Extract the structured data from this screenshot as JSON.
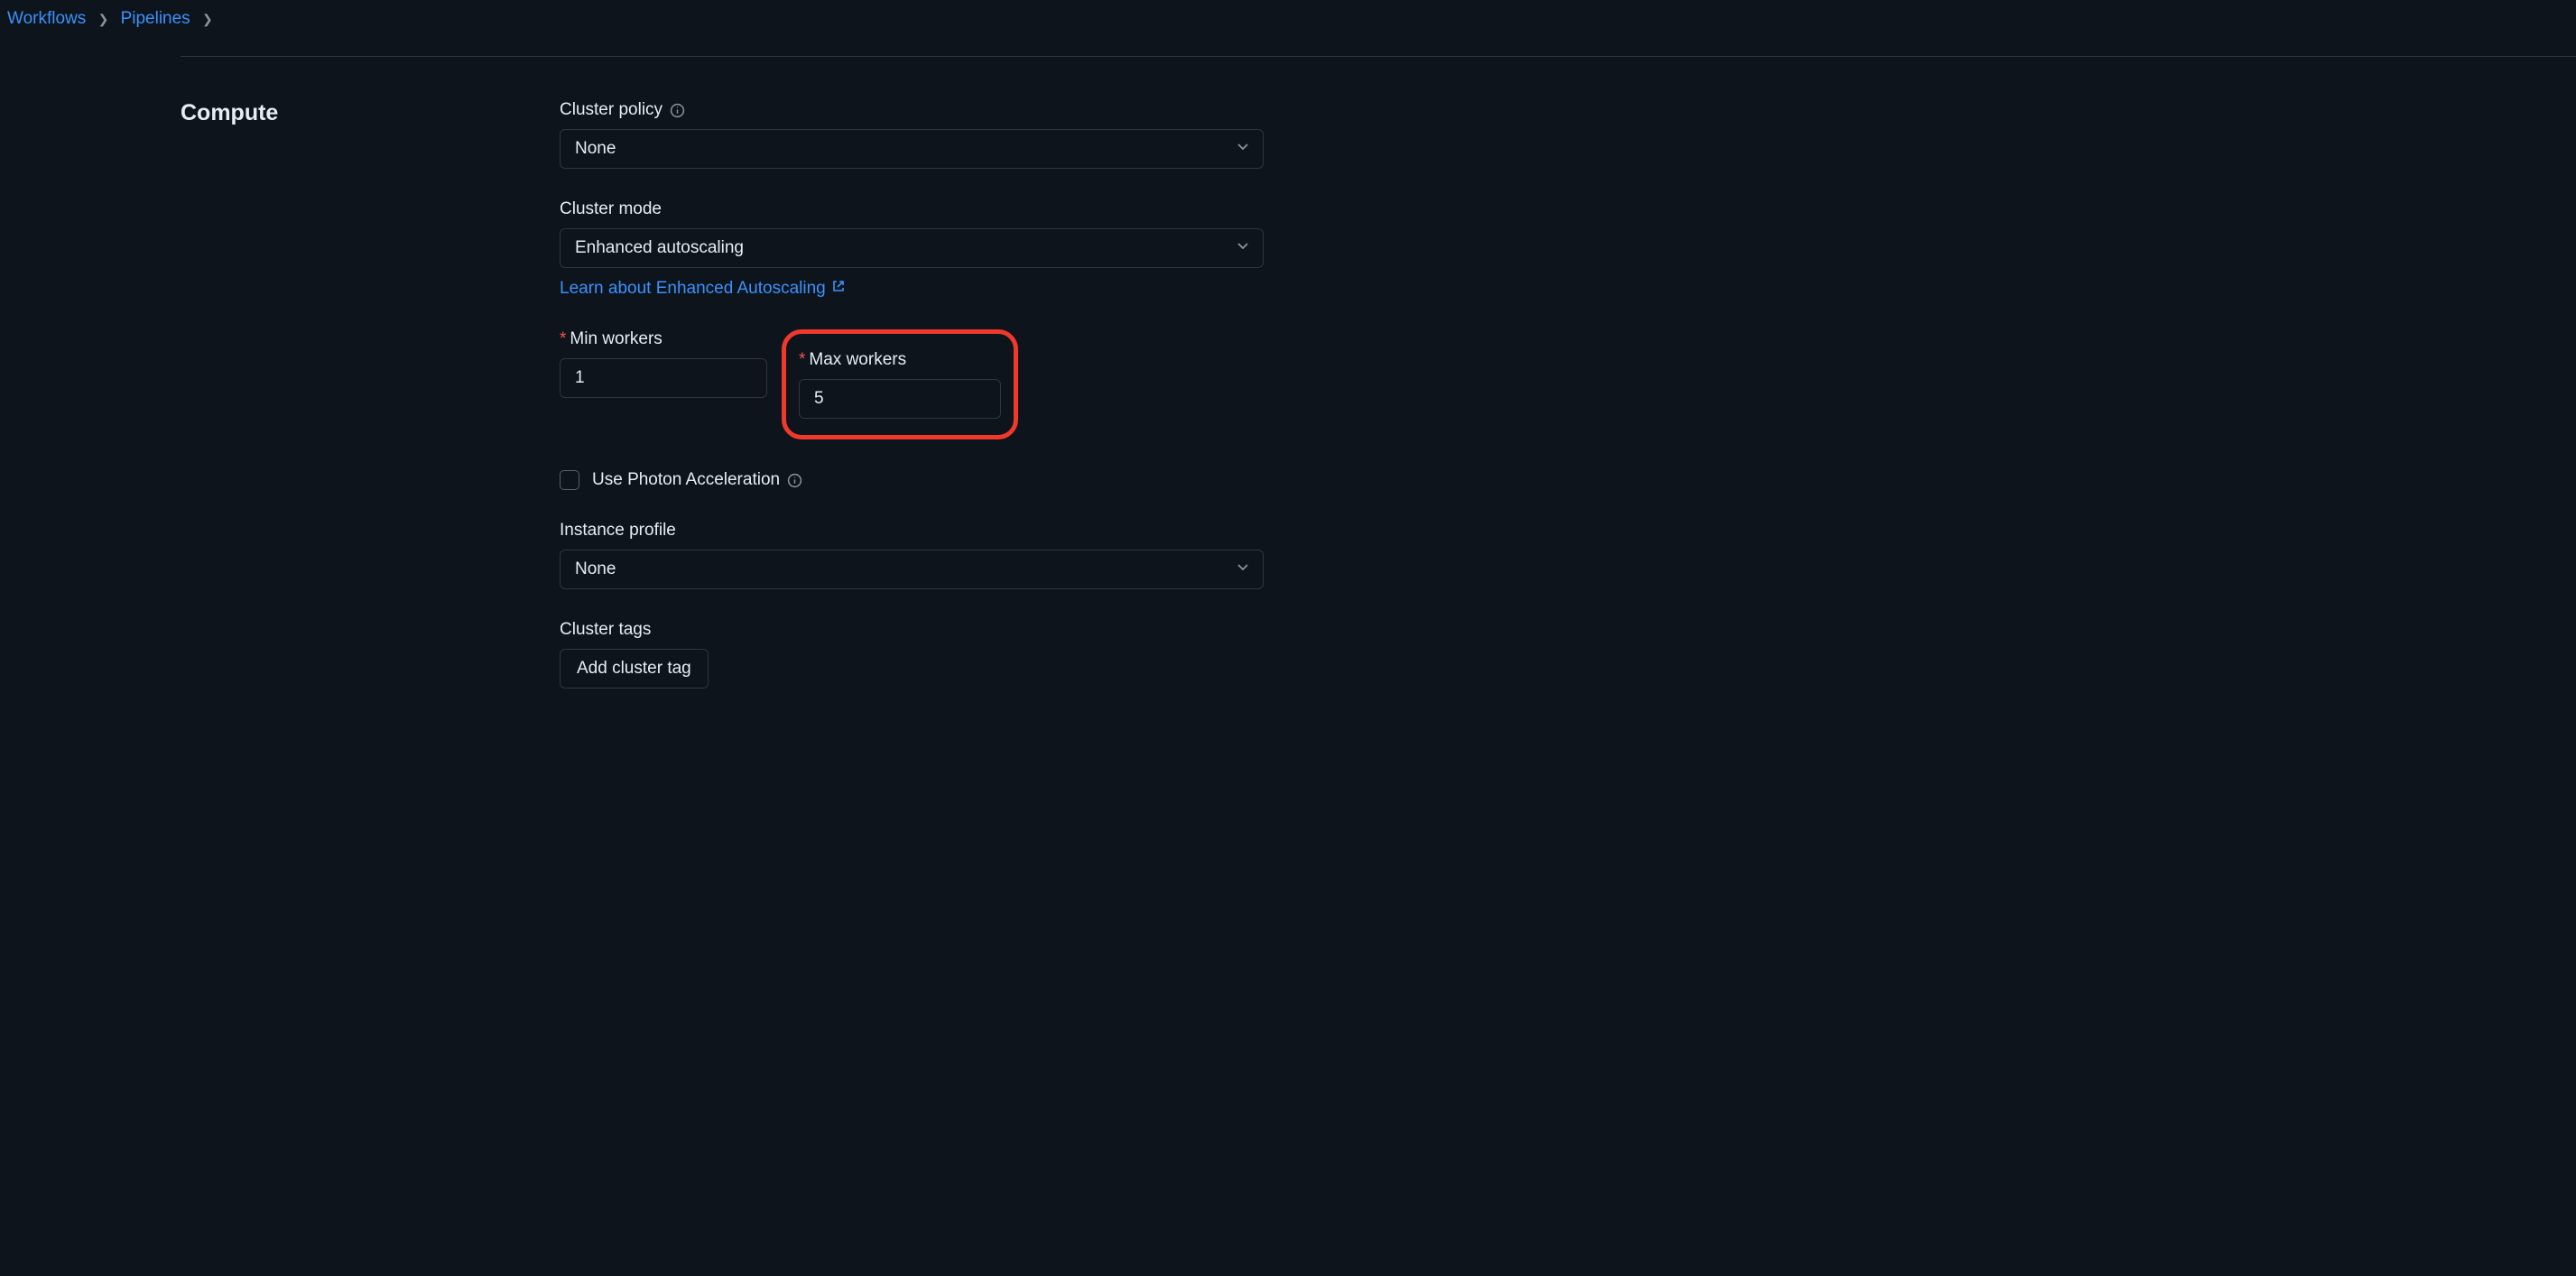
{
  "breadcrumb": {
    "item1": "Workflows",
    "item2": "Pipelines"
  },
  "section": {
    "title": "Compute"
  },
  "cluster_policy": {
    "label": "Cluster policy",
    "value": "None"
  },
  "cluster_mode": {
    "label": "Cluster mode",
    "value": "Enhanced autoscaling",
    "link_text": "Learn about Enhanced Autoscaling"
  },
  "min_workers": {
    "label": "Min workers",
    "value": "1"
  },
  "max_workers": {
    "label": "Max workers",
    "value": "5"
  },
  "photon": {
    "label": "Use Photon Acceleration"
  },
  "instance_profile": {
    "label": "Instance profile",
    "value": "None"
  },
  "cluster_tags": {
    "label": "Cluster tags",
    "button": "Add cluster tag"
  }
}
